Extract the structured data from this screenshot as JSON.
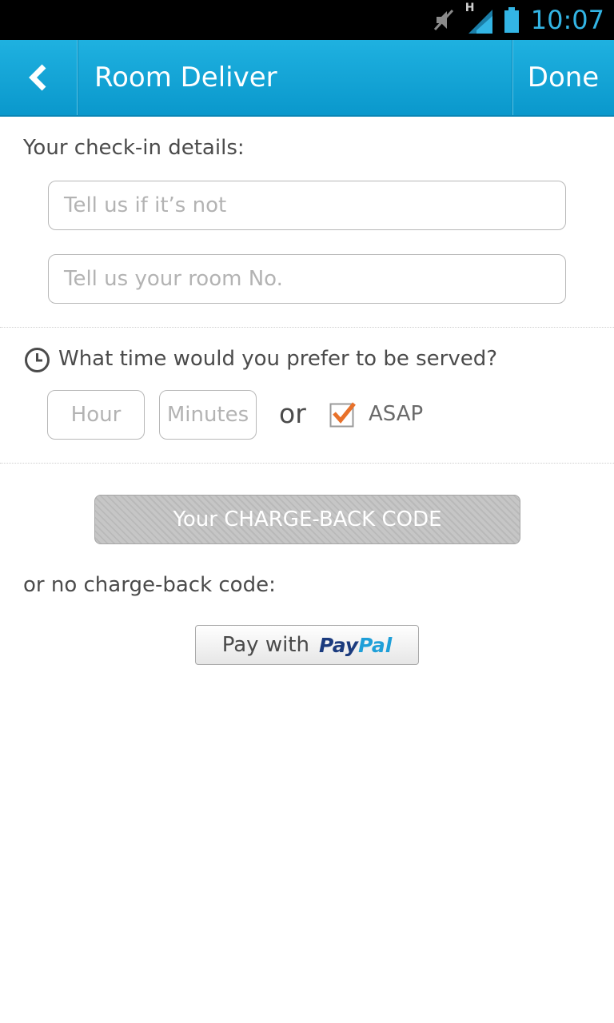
{
  "status_bar": {
    "time": "10:07",
    "network_type": "H",
    "icons": [
      "mute-icon",
      "signal-icon",
      "battery-icon"
    ]
  },
  "action_bar": {
    "back_icon": "back-chevron-icon",
    "title": "Room Deliver",
    "done_label": "Done"
  },
  "checkin": {
    "label": "Your check-in details:",
    "field1_placeholder": "Tell us if it’s not",
    "field2_placeholder": "Tell us your room No."
  },
  "time": {
    "question": "What time would you prefer to be served?",
    "hour_placeholder": "Hour",
    "minutes_placeholder": "Minutes",
    "or_text": "or",
    "asap_label": "ASAP",
    "asap_checked": true
  },
  "payment": {
    "charge_back_button": "Your CHARGE-BACK CODE",
    "no_code_label": "or no charge-back code:",
    "pay_with": "Pay with",
    "paypal_part1": "Pay",
    "paypal_part2": "Pal"
  },
  "colors": {
    "accent": "#33b5e5",
    "action_bar": "#0a98cc",
    "check": "#e8712a"
  }
}
